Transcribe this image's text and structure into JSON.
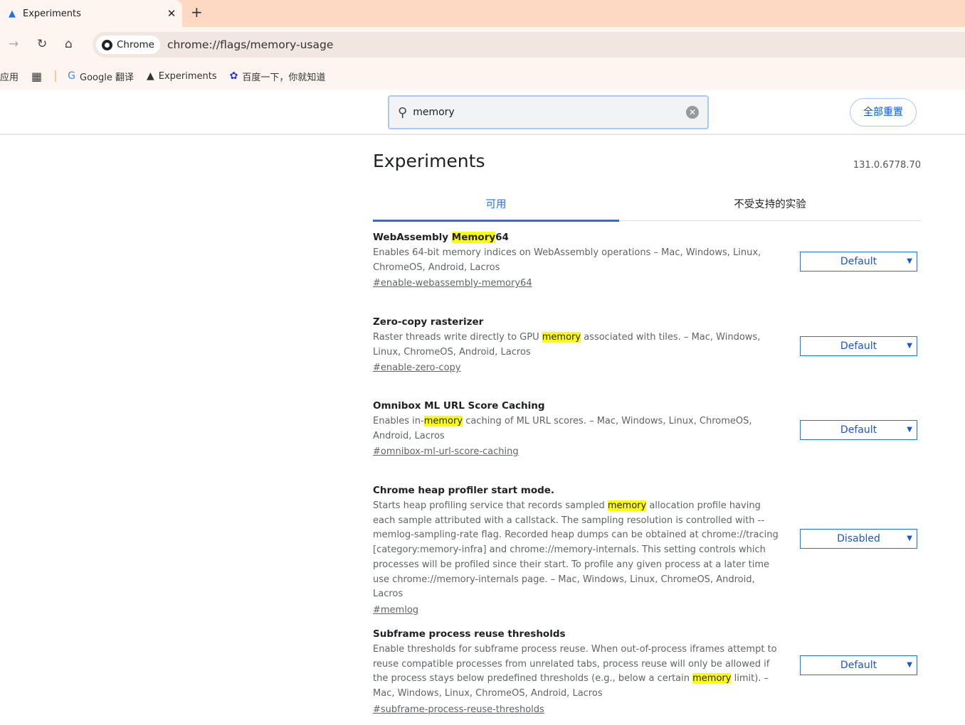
{
  "browser": {
    "tab_title": "Experiments",
    "chip": "Chrome",
    "url": "chrome://flags/memory-usage",
    "bookmarks": [
      {
        "label": "应用"
      },
      {
        "label": "Google 翻译"
      },
      {
        "label": "Experiments"
      },
      {
        "label": "百度一下，你就知道"
      }
    ]
  },
  "search": {
    "value": "memory",
    "reset_label": "全部重置"
  },
  "page": {
    "title": "Experiments",
    "version": "131.0.6778.70",
    "tabs": [
      {
        "label": "可用",
        "active": true
      },
      {
        "label": "不受支持的实验",
        "active": false
      }
    ]
  },
  "accent": "#1a73e8",
  "highlight": "#ffff00",
  "experiments": [
    {
      "title": {
        "pre": "WebAssembly ",
        "hl": "Memory",
        "post": "64"
      },
      "desc": {
        "pre": "Enables 64-bit memory indices on WebAssembly operations – Mac, Windows, Linux, ChromeOS, Android, Lacros",
        "hl": "",
        "post": ""
      },
      "link": "#enable-webassembly-memory64",
      "value": "Default"
    },
    {
      "title": {
        "pre": "Zero-copy rasterizer",
        "hl": "",
        "post": ""
      },
      "desc": {
        "pre": "Raster threads write directly to GPU ",
        "hl": "memory",
        "post": " associated with tiles. – Mac, Windows, Linux, ChromeOS, Android, Lacros"
      },
      "link": "#enable-zero-copy",
      "value": "Default"
    },
    {
      "title": {
        "pre": "Omnibox ML URL Score Caching",
        "hl": "",
        "post": ""
      },
      "desc": {
        "pre": "Enables in-",
        "hl": "memory",
        "post": " caching of ML URL scores. – Mac, Windows, Linux, ChromeOS, Android, Lacros"
      },
      "link": "#omnibox-ml-url-score-caching",
      "value": "Default"
    },
    {
      "title": {
        "pre": "Chrome heap profiler start mode.",
        "hl": "",
        "post": ""
      },
      "desc": {
        "pre": "Starts heap profiling service that records sampled ",
        "hl": "memory",
        "post": " allocation profile having each sample attributed with a callstack. The sampling resolution is controlled with --memlog-sampling-rate flag. Recorded heap dumps can be obtained at chrome://tracing [category:memory-infra] and chrome://memory-internals. This setting controls which processes will be profiled since their start. To profile any given process at a later time use chrome://memory-internals page. – Mac, Windows, Linux, ChromeOS, Android, Lacros"
      },
      "link": "#memlog",
      "value": "Disabled"
    },
    {
      "title": {
        "pre": "Subframe process reuse thresholds",
        "hl": "",
        "post": ""
      },
      "desc": {
        "pre": "Enable thresholds for subframe process reuse. When out-of-process iframes attempt to reuse compatible processes from unrelated tabs, process reuse will only be allowed if the process stays below predefined thresholds (e.g., below a certain ",
        "hl": "memory",
        "post": " limit). – Mac, Windows, Linux, ChromeOS, Android, Lacros"
      },
      "link": "#subframe-process-reuse-thresholds",
      "value": "Default"
    }
  ]
}
